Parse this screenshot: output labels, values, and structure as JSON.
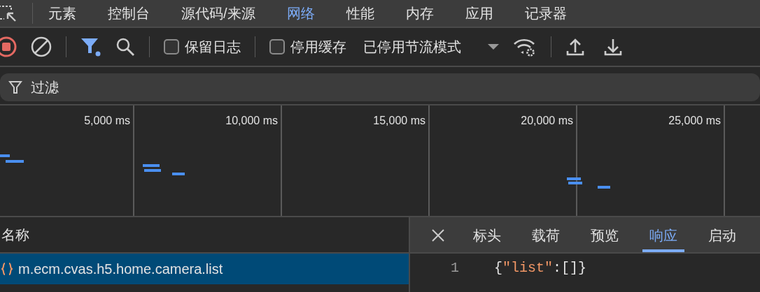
{
  "tabs": [
    {
      "label": "元素",
      "selected": false
    },
    {
      "label": "控制台",
      "selected": false
    },
    {
      "label": "源代码/来源",
      "selected": false
    },
    {
      "label": "网络",
      "selected": true
    },
    {
      "label": "性能",
      "selected": false
    },
    {
      "label": "内存",
      "selected": false
    },
    {
      "label": "应用",
      "selected": false
    },
    {
      "label": "记录器",
      "selected": false
    }
  ],
  "toolbar": {
    "recording": true,
    "filter_active": true,
    "preserve_log": {
      "label": "保留日志",
      "checked": false
    },
    "disable_cache": {
      "label": "停用缓存",
      "checked": false
    },
    "throttling": "已停用节流模式"
  },
  "filter": {
    "placeholder": "过滤"
  },
  "overview": {
    "ticks": [
      "5,000 ms",
      "10,000 ms",
      "15,000 ms",
      "20,000 ms",
      "25,000 ms"
    ]
  },
  "requests": {
    "column": "名称",
    "rows": [
      {
        "name": "m.ecm.cvas.h5.home.camera.list",
        "selected": true
      }
    ]
  },
  "detail_tabs": [
    {
      "label": "标头",
      "selected": false
    },
    {
      "label": "载荷",
      "selected": false
    },
    {
      "label": "预览",
      "selected": false
    },
    {
      "label": "响应",
      "selected": true
    },
    {
      "label": "启动",
      "selected": false
    }
  ],
  "response": {
    "lines": [
      {
        "number": "1",
        "tokens": [
          {
            "text": "{",
            "kind": "punct"
          },
          {
            "text": "\"list\"",
            "kind": "string"
          },
          {
            "text": ":[]}",
            "kind": "punct"
          }
        ]
      }
    ]
  }
}
